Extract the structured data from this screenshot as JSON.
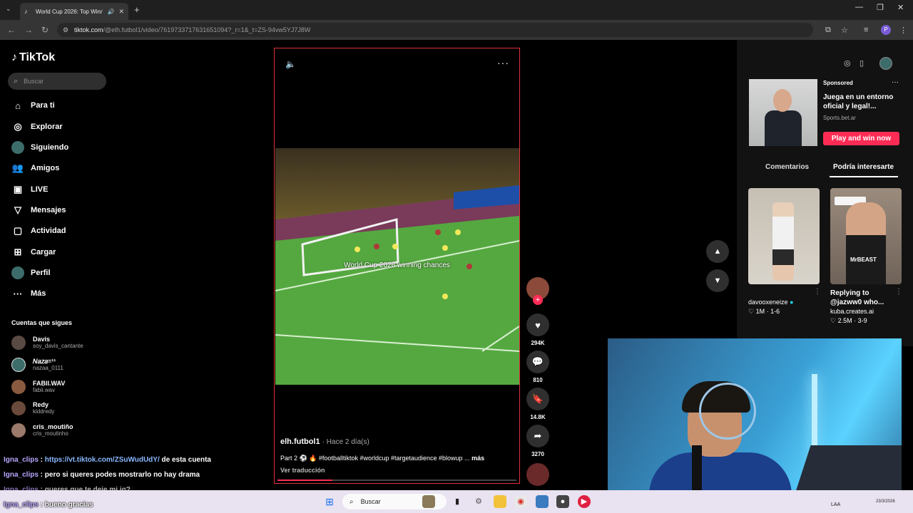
{
  "browser": {
    "tab_title": "World Cup 2026: Top Winni",
    "url_host": "tiktok.com",
    "url_path": "/@elh.futbol1/video/7619733717631651094?_r=1&_t=ZS-94vw5YJ7J8W"
  },
  "sidebar": {
    "brand": "TikTok",
    "search_placeholder": "Buscar",
    "items": [
      {
        "label": "Para ti",
        "icon": "home-icon"
      },
      {
        "label": "Explorar",
        "icon": "compass-icon"
      },
      {
        "label": "Siguiendo",
        "icon": "following-avatar-icon"
      },
      {
        "label": "Amigos",
        "icon": "friends-icon"
      },
      {
        "label": "LIVE",
        "icon": "live-icon"
      },
      {
        "label": "Mensajes",
        "icon": "messages-icon"
      },
      {
        "label": "Actividad",
        "icon": "activity-icon"
      },
      {
        "label": "Cargar",
        "icon": "upload-icon"
      },
      {
        "label": "Perfil",
        "icon": "profile-avatar-icon"
      },
      {
        "label": "Más",
        "icon": "more-icon"
      }
    ],
    "following_header": "Cuentas que sigues",
    "following": [
      {
        "name": "Davis",
        "handle": "soy_davis_cantante"
      },
      {
        "name": "𝑁𝑎𝑧𝑎=¹¹",
        "handle": "nazaa_0111"
      },
      {
        "name": "FABII.WAV",
        "handle": "fabii.wav"
      },
      {
        "name": "Redy",
        "handle": "kiddredy"
      },
      {
        "name": "cris_moutiño",
        "handle": "cris_moutinho"
      }
    ]
  },
  "video": {
    "overlay_caption": "World Cup 2026 winning chances",
    "author": "elh.futbol1",
    "posted": "· Hace 2 día(s)",
    "description": "Part 2 ⚽ 🔥 #footballtiktok #worldcup #targetaudience #blowup ...",
    "more_label": "más",
    "translate_label": "Ver traducción",
    "progress": 0.23
  },
  "actions": {
    "likes": "294K",
    "comments": "810",
    "saves": "14.8K",
    "shares": "3270"
  },
  "right_panel": {
    "sponsored_label": "Sponsored",
    "ad_title": "Juega en un entorno oficial y legal!...",
    "ad_site": "Sports.bet.ar",
    "ad_button": "Play and win now",
    "tabs": [
      "Comentarios",
      "Podría interesarte"
    ],
    "active_tab": "Podría interesarte",
    "suggestions": [
      {
        "user": "davooxeneize",
        "likes": "1M",
        "meta": "1-6"
      },
      {
        "caption_line1": "Replying to",
        "caption_line2": "@jazww0 who...",
        "user": "kuba.creates.ai",
        "likes": "2.5M",
        "meta": "3-9",
        "thumb_text": "MrBEAST"
      }
    ]
  },
  "chat": [
    {
      "user": "Igna_clips",
      "link": "https://vt.tiktok.com/ZSuWudUdY/",
      "text": "de esta cuenta"
    },
    {
      "user": "Igna_clips",
      "text": "pero si queres podes mostrarlo no hay drama"
    },
    {
      "user": "Igna_clips",
      "text": "queres que te deje mi ig?"
    },
    {
      "user": "Igna_clips",
      "text": "bueno gracias"
    }
  ],
  "taskbar": {
    "search_placeholder": "Buscar",
    "lang": "LAA",
    "date": "23/3/2026"
  },
  "colors": {
    "accent": "#fe2c55",
    "video_border": "#e0303a",
    "chat_user": "#b9a6ff"
  }
}
